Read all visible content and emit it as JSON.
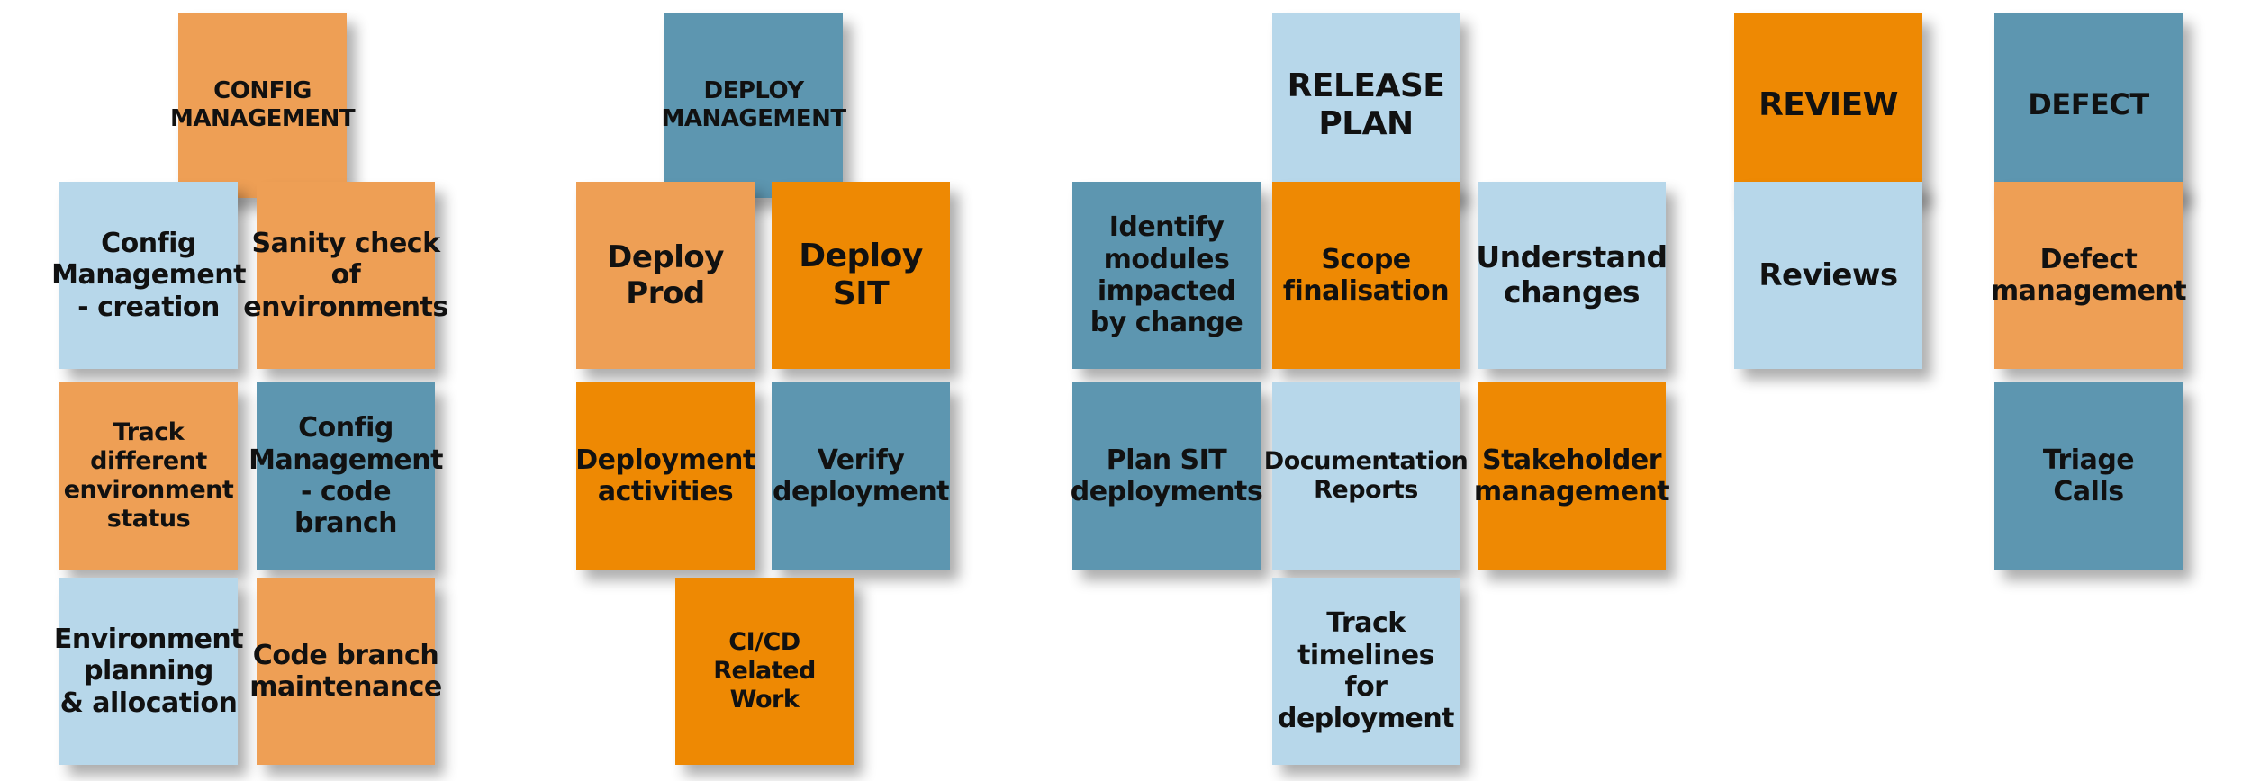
{
  "colors": {
    "light_orange": "#EE9F55",
    "dark_orange": "#EE8903",
    "teal": "#5D96B0",
    "light_blue": "#B7D7EA"
  },
  "groups": [
    {
      "header": "CONFIG\nMANAGEMENT",
      "cards": [
        "Config\nManagement\n- creation",
        "Sanity check\nof\nenvironments",
        "Track different\nenvironment\nstatus",
        "Config\nManagement\n- code branch",
        "Environment\nplanning\n& allocation",
        "Code branch\nmaintenance"
      ]
    },
    {
      "header": "DEPLOY\nMANAGEMENT",
      "cards": [
        "Deploy\nProd",
        "Deploy\nSIT",
        "Deployment\nactivities",
        "Verify\ndeployment",
        "CI/CD\nRelated Work"
      ]
    },
    {
      "header": "RELEASE\nPLAN",
      "cards": [
        "Identify\nmodules\nimpacted\nby change",
        "Scope\nfinalisation",
        "Understand\nchanges",
        "Plan SIT\ndeployments",
        "Documentation\nReports",
        "Stakeholder\nmanagement",
        "Track\ntimelines\nfor\ndeployment"
      ]
    },
    {
      "header": "REVIEW",
      "cards": [
        "Reviews"
      ]
    },
    {
      "header": "DEFECT",
      "cards": [
        "Defect\nmanagement",
        "Triage\nCalls"
      ]
    }
  ]
}
